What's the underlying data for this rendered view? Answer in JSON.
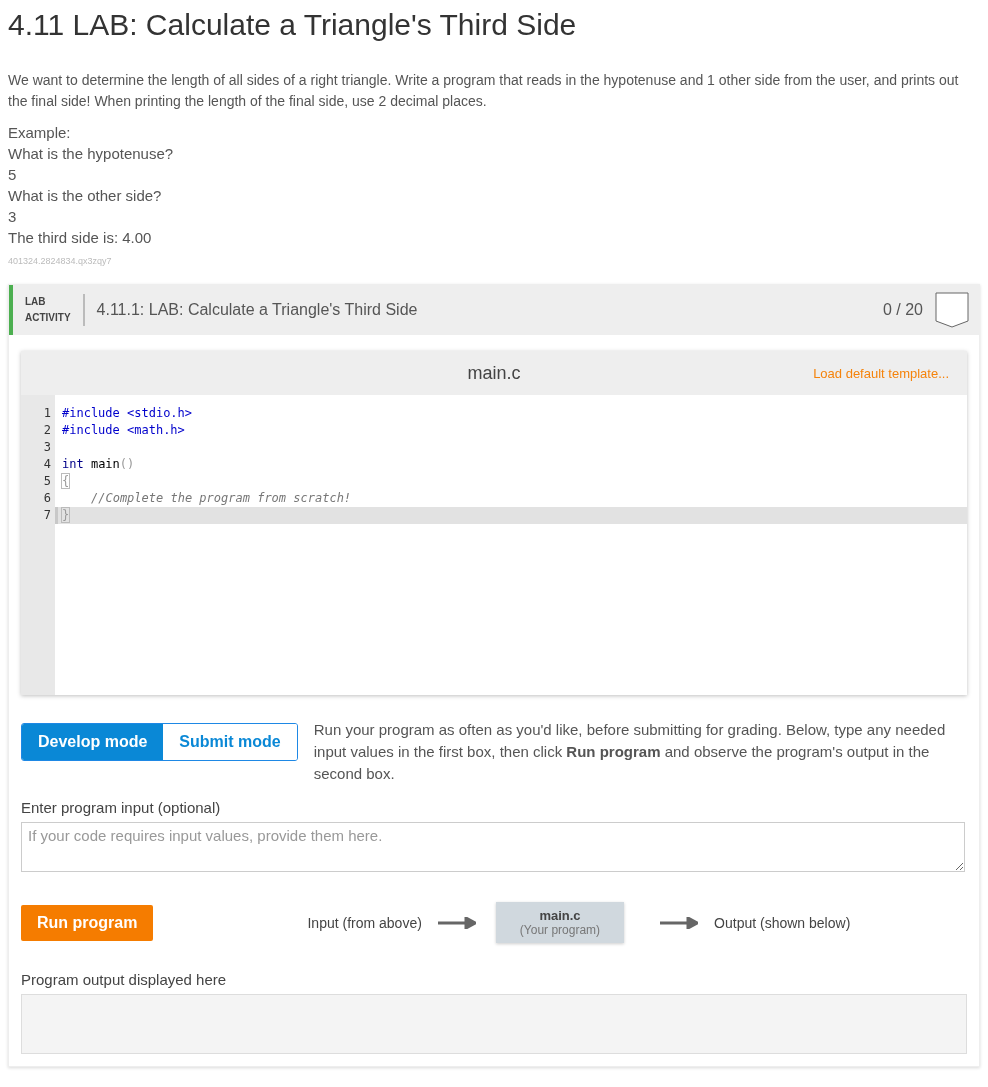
{
  "title": "4.11 LAB: Calculate a Triangle's Third Side",
  "description": "We want to determine the length of all sides of a right triangle. Write a program that reads in the hypotenuse and 1 other side from the user, and prints out the final side! When printing the length of the final side, use 2 decimal places.",
  "example_lines": [
    "Example:",
    "What is the hypotenuse?",
    "5",
    "What is the other side?",
    "3",
    "The third side is: 4.00"
  ],
  "lab_id": "401324.2824834.qx3zqy7",
  "activity": {
    "label_lines": [
      "LAB",
      "ACTIVITY"
    ],
    "title": "4.11.1: LAB: Calculate a Triangle's Third Side",
    "score": "0 / 20"
  },
  "editor": {
    "filename": "main.c",
    "load_template": "Load default template...",
    "lines": [
      {
        "number": "1",
        "active": false,
        "segments": [
          {
            "kind": "preproc",
            "text": "#include <stdio.h>"
          }
        ]
      },
      {
        "number": "2",
        "active": false,
        "segments": [
          {
            "kind": "preproc",
            "text": "#include <math.h>"
          }
        ]
      },
      {
        "number": "3",
        "active": false
      },
      {
        "number": "4",
        "active": false,
        "segments": [
          {
            "kind": "type",
            "text": "int"
          },
          {
            "kind": "plain",
            "text": " main"
          },
          {
            "kind": "paren",
            "text": "()"
          }
        ]
      },
      {
        "number": "5",
        "active": false,
        "segments": [
          {
            "kind": "brace",
            "text": "{"
          }
        ]
      },
      {
        "number": "6",
        "active": false,
        "segments": [
          {
            "kind": "comment",
            "text": "//Complete the program from scratch!"
          }
        ]
      },
      {
        "number": "7",
        "active": true,
        "segments": [
          {
            "kind": "brace",
            "text": "}"
          }
        ]
      }
    ]
  },
  "modes": [
    {
      "label": "Develop mode",
      "selected": true
    },
    {
      "label": "Submit mode",
      "selected": false
    }
  ],
  "mode_help": "Run your program as often as you'd like, before submitting for grading. Below, type any needed input values in the first box, then click **Run program** and observe the program's output in the second box.",
  "input": {
    "label": "Enter program input (optional)",
    "placeholder": "If your code requires input values, provide them here."
  },
  "run_button": "Run program",
  "flow": {
    "input": "Input (from above)",
    "program_name": "main.c",
    "program_sub": "(Your program)",
    "output": "Output (shown below)"
  },
  "output_label": "Program output displayed here"
}
